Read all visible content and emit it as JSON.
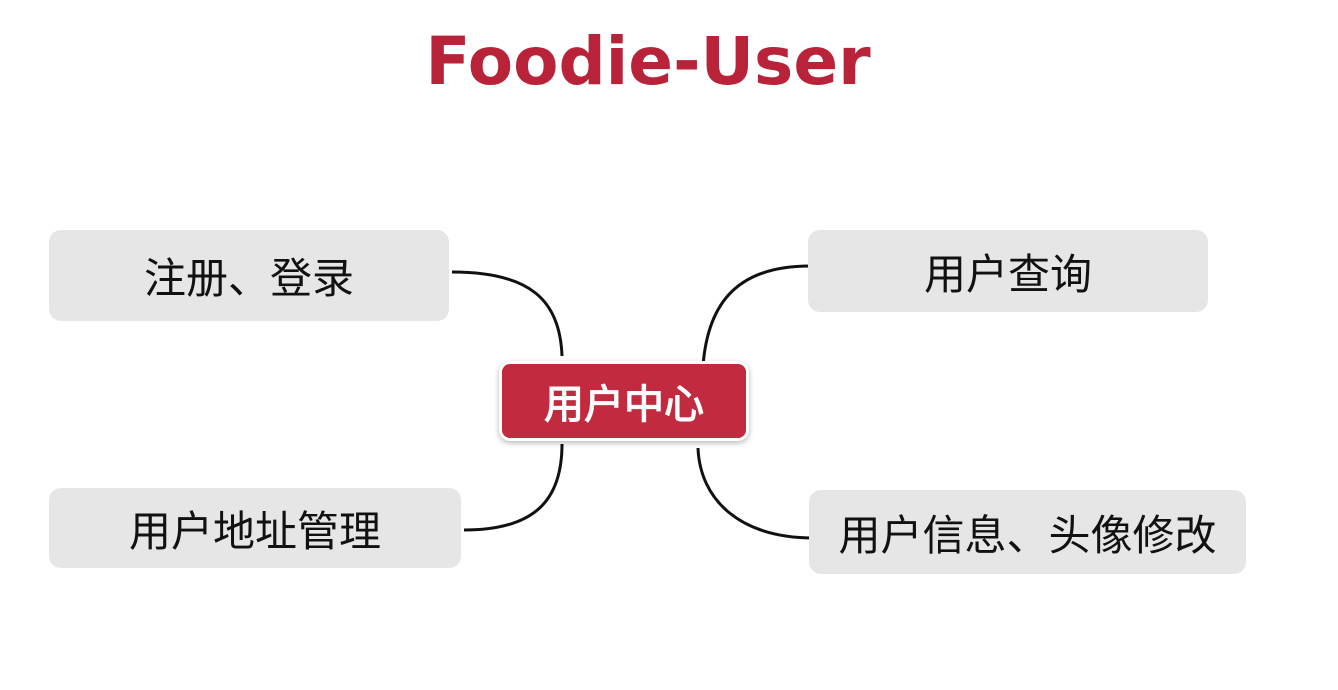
{
  "title": "Foodie-User",
  "center_node": {
    "label": "用户中心",
    "color": "#c22a40"
  },
  "branches": [
    {
      "label": "注册、登录"
    },
    {
      "label": "用户查询"
    },
    {
      "label": "用户地址管理"
    },
    {
      "label": "用户信息、头像修改"
    }
  ],
  "colors": {
    "title": "#b8233a",
    "node_background": "#e6e6e6",
    "connector": "#111111"
  }
}
